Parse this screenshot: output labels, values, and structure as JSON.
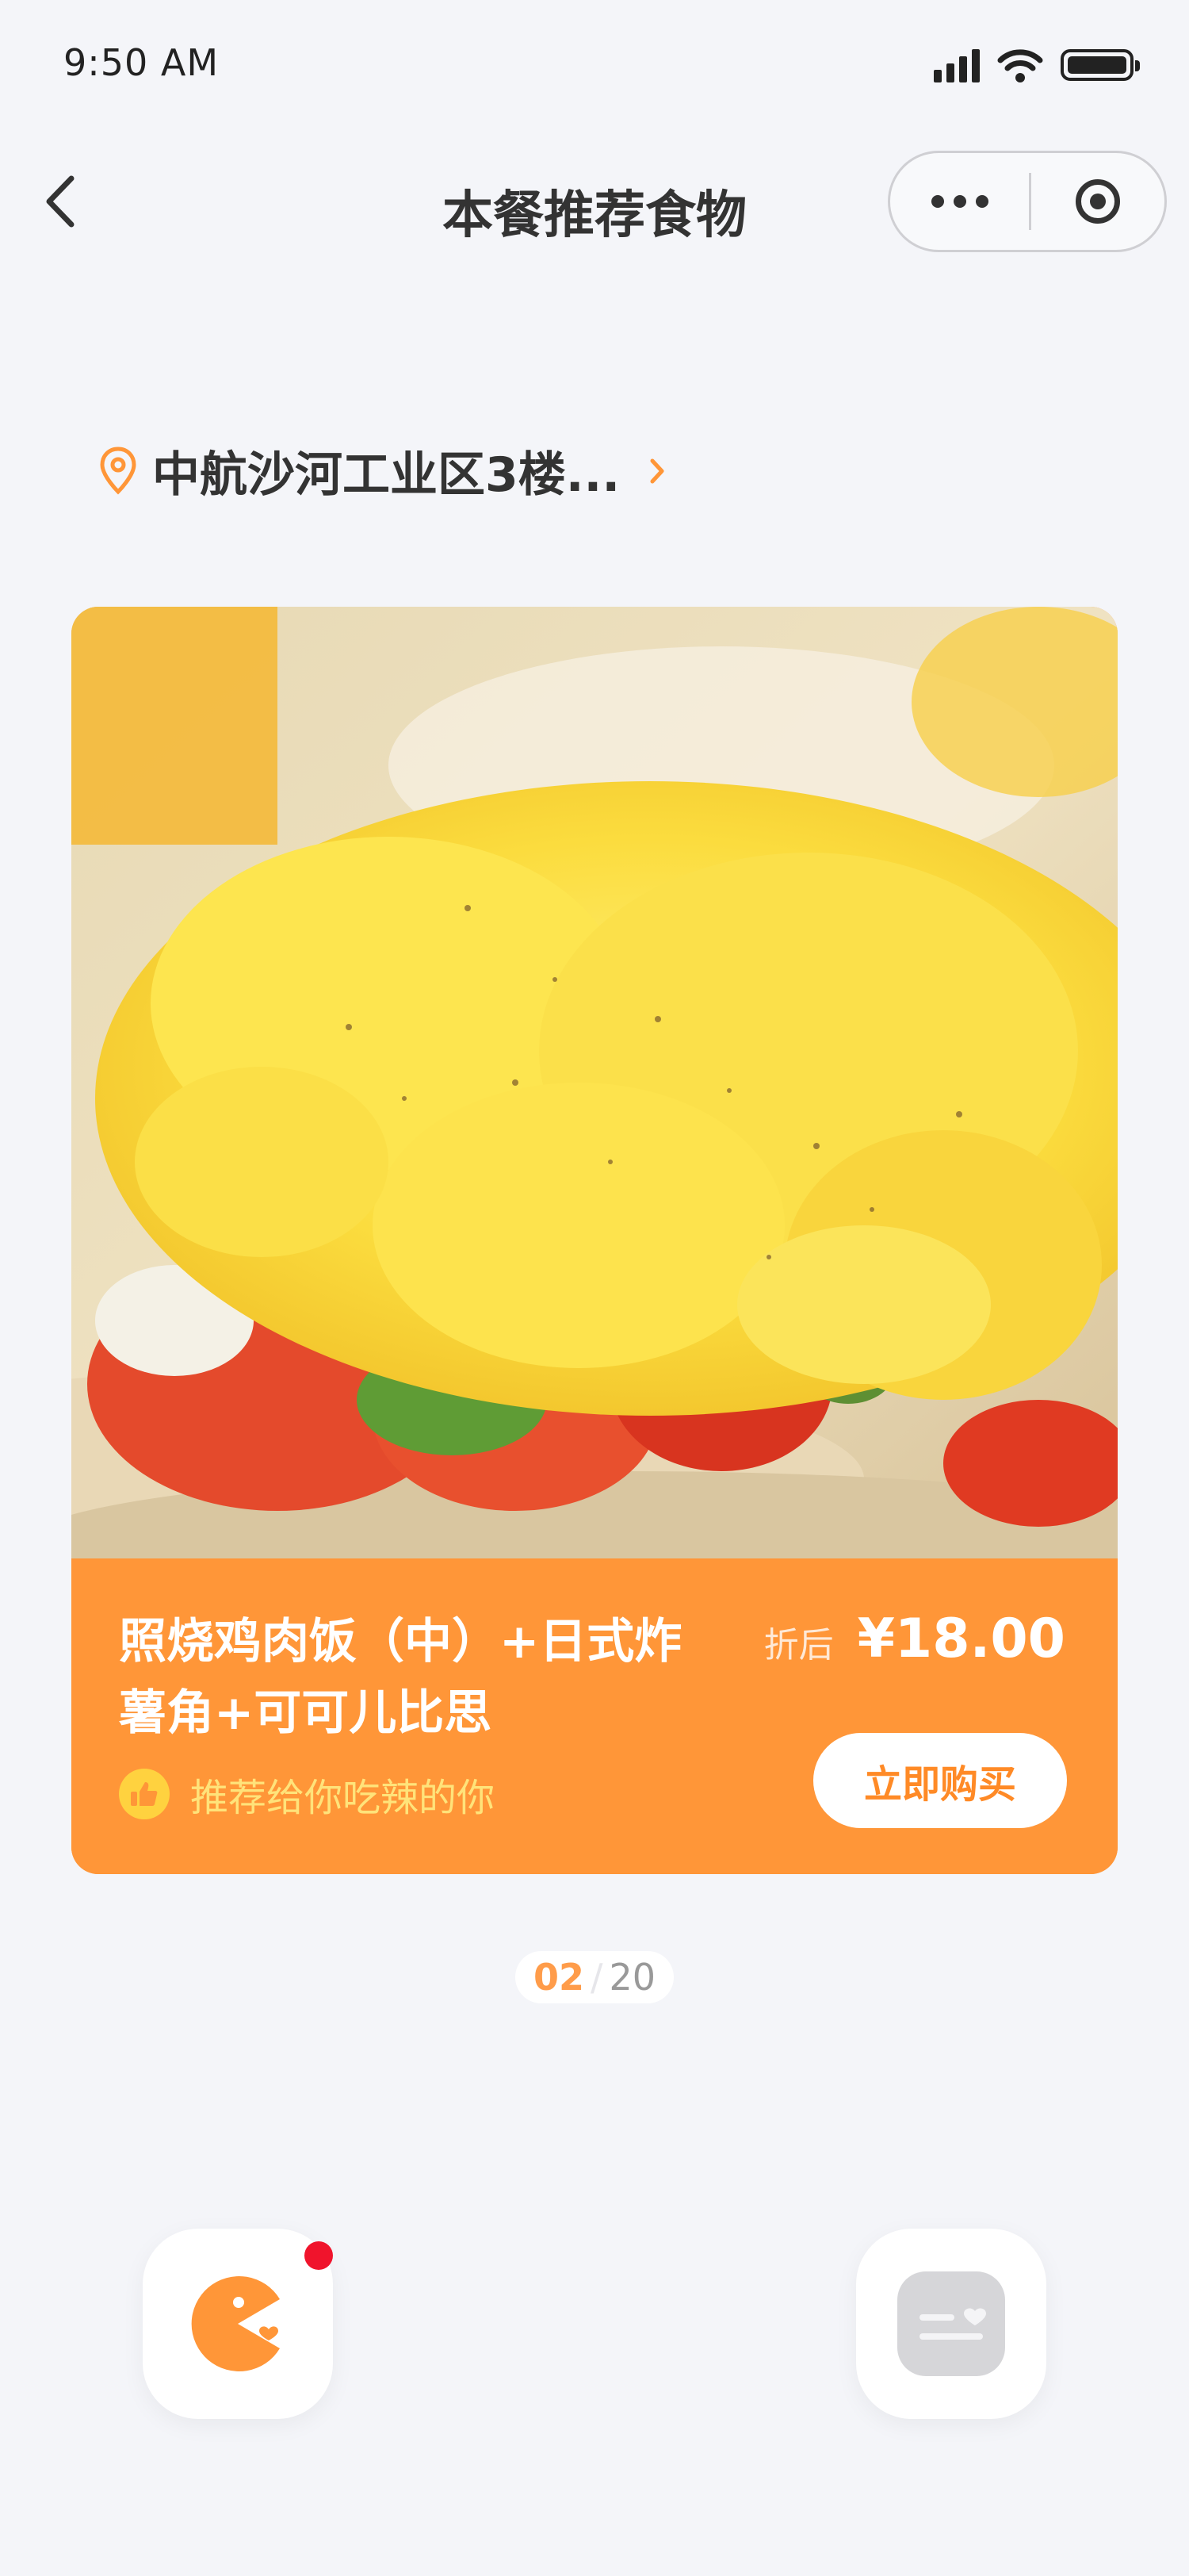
{
  "status_bar": {
    "time": "9:50 AM"
  },
  "navbar": {
    "title": "本餐推荐食物"
  },
  "location": {
    "address": "中航沙河工业区3楼..."
  },
  "card": {
    "dish_name": "照烧鸡肉饭（中）+日式炸薯角+可可儿比思",
    "recommend_text": "推荐给你吃辣的你",
    "price_label": "折后",
    "price": "¥18.00",
    "buy_label": "立即购买"
  },
  "pager": {
    "current": "02",
    "separator": "/",
    "total": "20"
  },
  "colors": {
    "accent": "#ff9638",
    "background": "#f4f5f9",
    "notification": "#f0142c",
    "recommend_text": "#ffe37a"
  },
  "icons": {
    "back": "chevron-left-icon",
    "more": "more-dots-icon",
    "close": "target-circle-icon",
    "location": "location-pin-icon",
    "location_arrow": "chevron-right-icon",
    "thumb": "thumbs-up-icon",
    "left_button": "pacman-heart-icon",
    "right_button": "card-heart-icon"
  }
}
